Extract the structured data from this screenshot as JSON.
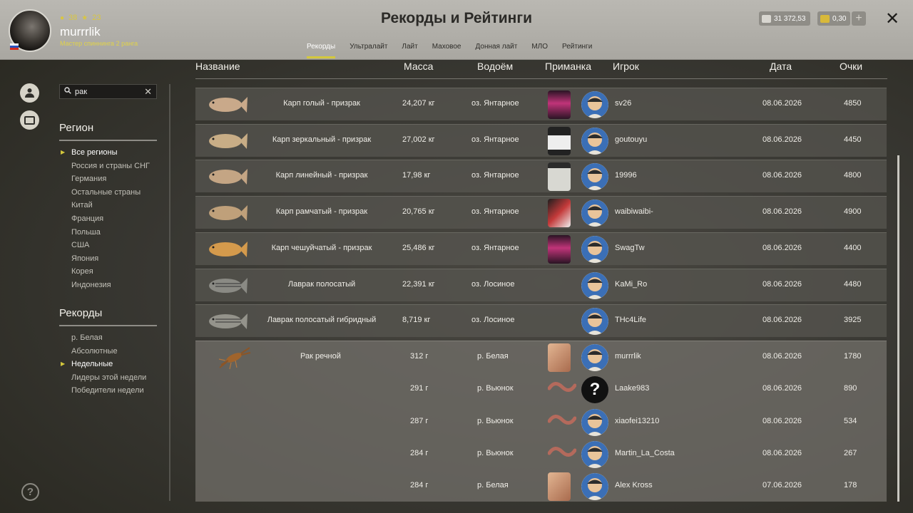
{
  "profile": {
    "stat_a": "38",
    "stat_b": "23",
    "username": "murrrlik",
    "rank": "Мастер спиннинга 2 ранга"
  },
  "header": {
    "title": "Рекорды и Рейтинги",
    "tabs": [
      "Рекорды",
      "Ультралайт",
      "Лайт",
      "Маховое",
      "Донная лайт",
      "МЛО",
      "Рейтинги"
    ],
    "active_tab": "Рекорды",
    "silver": "31 372,53",
    "gold": "0,30",
    "plus": "+",
    "close": "✕"
  },
  "sidebar": {
    "search_value": "рак",
    "region_title": "Регион",
    "regions": [
      "Все регионы",
      "Россия и страны СНГ",
      "Германия",
      "Остальные страны",
      "Китай",
      "Франция",
      "Польша",
      "США",
      "Япония",
      "Корея",
      "Индонезия"
    ],
    "records_title": "Рекорды",
    "records": [
      "р. Белая",
      "Абсолютные",
      "Недельные",
      "Лидеры этой недели",
      "Победители недели"
    ],
    "help": "?"
  },
  "table": {
    "columns": {
      "name": "Название",
      "mass": "Масса",
      "water": "Водоём",
      "bait": "Приманка",
      "player": "Игрок",
      "date": "Дата",
      "points": "Очки"
    },
    "rows": [
      {
        "name": "Карп голый - призрак",
        "mass": "24,207 кг",
        "water": "оз. Янтарное",
        "player": "sv26",
        "date": "08.06.2026",
        "points": "4850"
      },
      {
        "name": "Карп зеркальный - призрак",
        "mass": "27,002 кг",
        "water": "оз. Янтарное",
        "player": "goutouyu",
        "date": "08.06.2026",
        "points": "4450"
      },
      {
        "name": "Карп линейный - призрак",
        "mass": "17,98 кг",
        "water": "оз. Янтарное",
        "player": "19996",
        "date": "08.06.2026",
        "points": "4800"
      },
      {
        "name": "Карп рамчатый - призрак",
        "mass": "20,765 кг",
        "water": "оз. Янтарное",
        "player": "waibiwaibi-",
        "date": "08.06.2026",
        "points": "4900"
      },
      {
        "name": "Карп чешуйчатый - призрак",
        "mass": "25,486 кг",
        "water": "оз. Янтарное",
        "player": "SwagTw",
        "date": "08.06.2026",
        "points": "4400"
      },
      {
        "name": "Лаврак полосатый",
        "mass": "22,391 кг",
        "water": "оз. Лосиное",
        "player": "KaMi_Ro",
        "date": "08.06.2026",
        "points": "4480"
      },
      {
        "name": "Лаврак полосатый гибридный",
        "mass": "8,719 кг",
        "water": "оз. Лосиное",
        "player": "THc4Life",
        "date": "08.06.2026",
        "points": "3925"
      }
    ],
    "group": {
      "name": "Рак речной",
      "entries": [
        {
          "mass": "312 г",
          "water": "р. Белая",
          "player": "murrrlik",
          "date": "08.06.2026",
          "points": "1780"
        },
        {
          "mass": "291 г",
          "water": "р. Вьюнок",
          "player": "Laake983",
          "date": "08.06.2026",
          "points": "890"
        },
        {
          "mass": "287 г",
          "water": "р. Вьюнок",
          "player": "xiaofei13210",
          "date": "08.06.2026",
          "points": "534"
        },
        {
          "mass": "284 г",
          "water": "р. Вьюнок",
          "player": "Martin_La_Costa",
          "date": "08.06.2026",
          "points": "267"
        },
        {
          "mass": "284 г",
          "water": "р. Белая",
          "player": "Alex Kross",
          "date": "07.06.2026",
          "points": "178"
        }
      ]
    }
  },
  "colors": {
    "accent": "#d4c83c",
    "row_bg": "#585650",
    "topbar": "#b1afa9"
  }
}
